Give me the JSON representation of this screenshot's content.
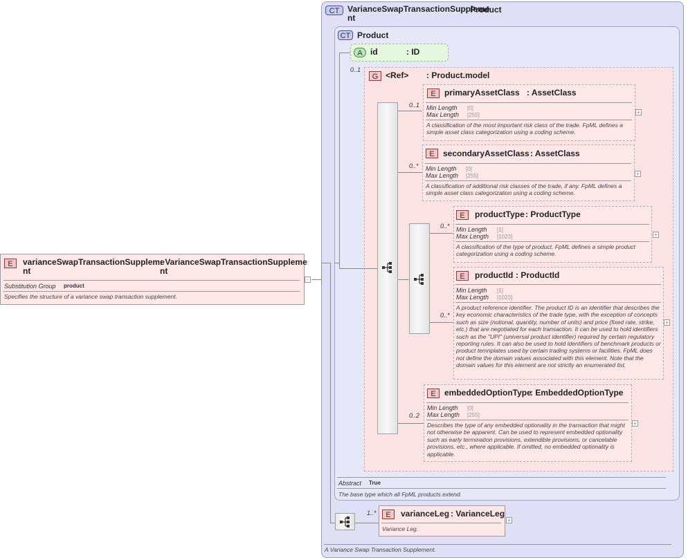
{
  "root": {
    "badge": "E",
    "name": "varianceSwapTransactionSuppleme\nnt",
    "type": ": VarianceSwapTransactionSuppleme\nnt",
    "substitution_label": "Substitution Group",
    "substitution_value": "product",
    "description": "Specifies the structure of a variance swap transaction supplement."
  },
  "complex_type": {
    "badge": "CT",
    "name": "VarianceSwapTransactionSuppleme\nnt",
    "base": ": Product",
    "description": "A Variance Swap Transaction Supplement."
  },
  "product": {
    "badge": "CT",
    "name": "Product",
    "abstract_label": "Abstract",
    "abstract_value": "True",
    "description": "The base type which all FpML products extend.",
    "attribute": {
      "badge": "A",
      "name": "id",
      "type": ": ID"
    },
    "group": {
      "badge": "G",
      "name": "<Ref>",
      "type": ": Product.model",
      "cardinality": "0..1"
    }
  },
  "elements": [
    {
      "badge": "E",
      "name": "primaryAssetClass",
      "type": ": AssetClass",
      "cardinality": "0..1",
      "min_label": "Min Length",
      "min_value": "[0]",
      "max_label": "Max Length",
      "max_value": "[255]",
      "description": "A classification of the most important risk class of the trade. FpML defines a simple asset class categorization using a coding scheme."
    },
    {
      "badge": "E",
      "name": "secondaryAssetClass",
      "type": ": AssetClass",
      "cardinality": "0..*",
      "min_label": "Min Length",
      "min_value": "[0]",
      "max_label": "Max Length",
      "max_value": "[255]",
      "description": "A classification of additional risk classes of the trade, if any. FpML defines a simple asset class categorization using a coding scheme."
    },
    {
      "badge": "E",
      "name": "productType",
      "type": ": ProductType",
      "cardinality": "0..*",
      "min_label": "Min Length",
      "min_value": "[1]",
      "max_label": "Max Length",
      "max_value": "[1023]",
      "description": "A classification of the type of product. FpML defines a simple product categorization using a coding scheme."
    },
    {
      "badge": "E",
      "name": "productId",
      "type": ": ProductId",
      "cardinality": "0..*",
      "min_label": "Min Length",
      "min_value": "[1]",
      "max_label": "Max Length",
      "max_value": "[1023]",
      "description": "A product reference identifier. The product ID is an identifier that describes the key economic characteristics of the trade type, with the exception of concepts such as size (notional, quantity, number of units) and price (fixed rate, strike, etc.) that are negotiated for each transaction. It can be used to hold identifiers such as the \"UPI\" (universal product identifier) required by certain regulatory reporting rules. It can also be used to hold identifiers of benchmark products or product temnplates used by certain trading systems or facilities. FpML does not define the domain values associated with this element. Note that the domain values for this element are not strictly an enumerated list."
    },
    {
      "badge": "E",
      "name": "embeddedOptionType",
      "type": ": EmbeddedOptionType",
      "cardinality": "0..2",
      "min_label": "Min Length",
      "min_value": "[0]",
      "max_label": "Max Length",
      "max_value": "[255]",
      "description": "Describes the type of any embedded optionality in the transaction that might not otherwise be apparent. Can be used to represent embedded optionality such as early termination provisions, extendible provisions, or cancelable provisions, etc., where applicable. If omitted, no embedded optionality is applicable."
    }
  ],
  "variance_leg": {
    "badge": "E",
    "name": "varianceLeg",
    "type": ": VarianceLeg",
    "cardinality": "1..*",
    "description": "Variance Leg."
  },
  "icons": {
    "expander": "+",
    "collapse": "-"
  }
}
